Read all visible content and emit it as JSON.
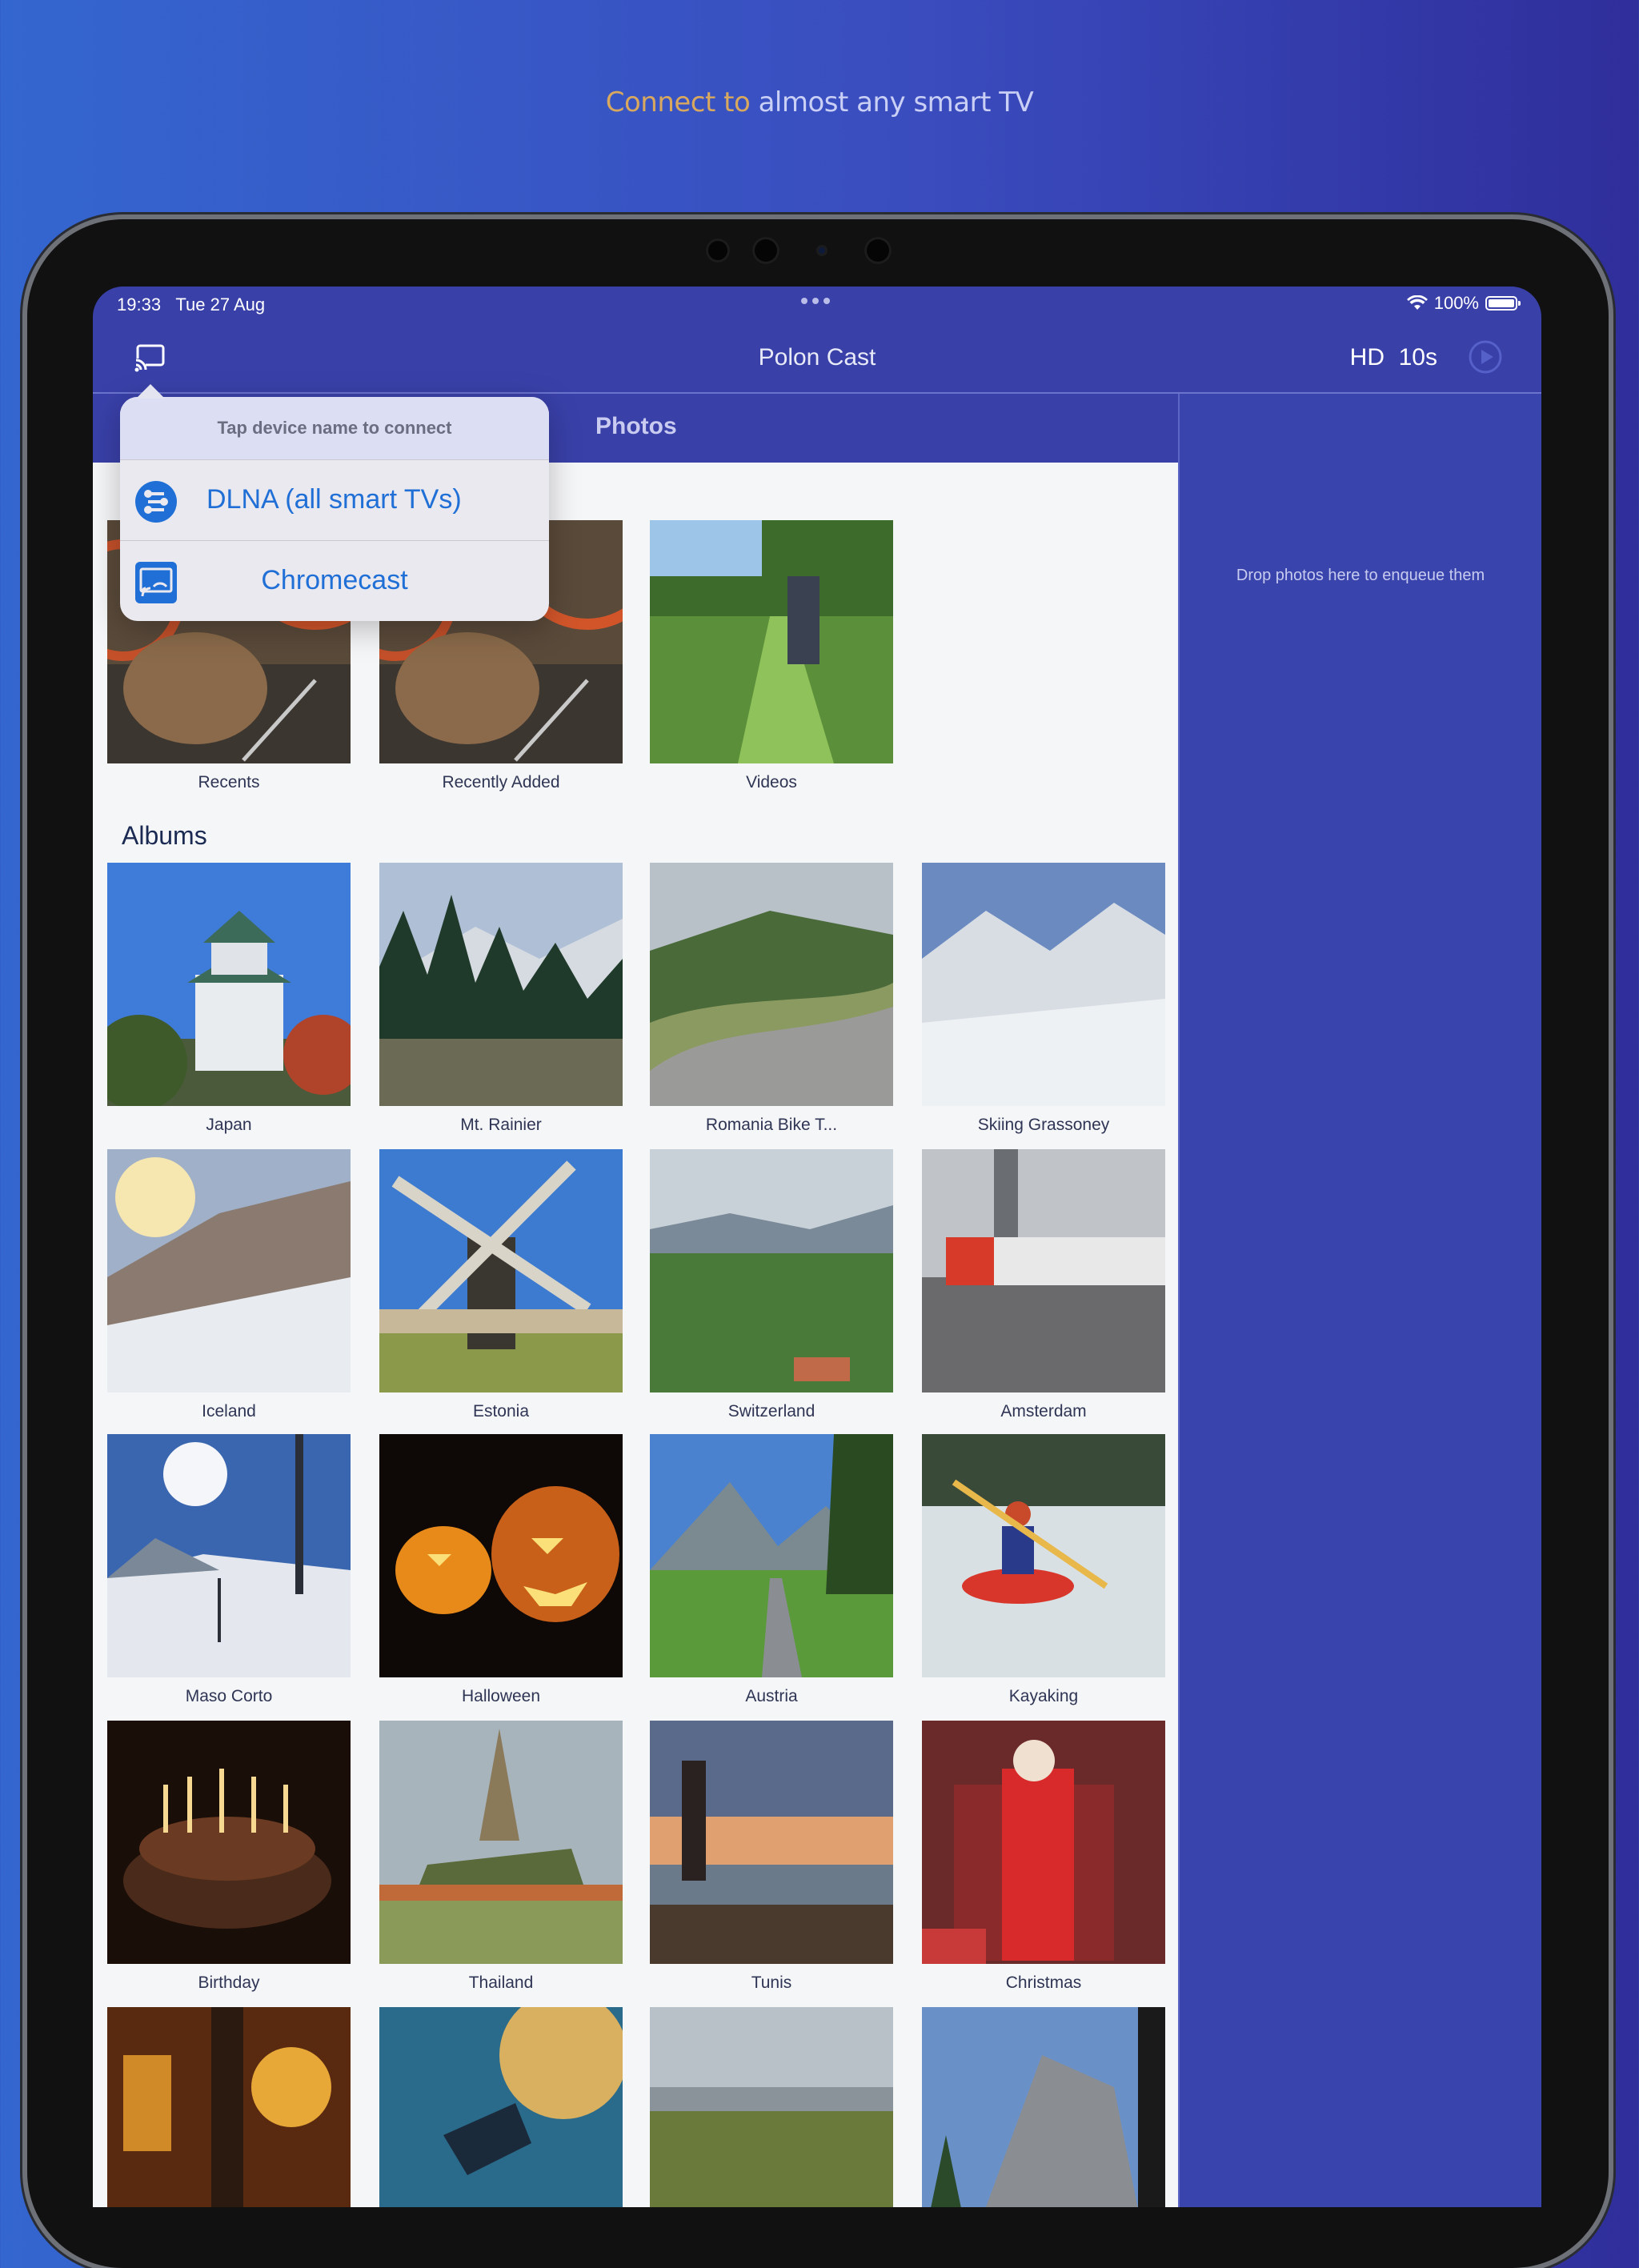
{
  "headline": {
    "part1": "Connect to",
    "part2": " almost any smart TV"
  },
  "status": {
    "time": "19:33",
    "date": "Tue 27 Aug",
    "battery": "100%"
  },
  "nav": {
    "title": "Polon Cast",
    "quality": "HD",
    "interval": "10s"
  },
  "tabs": {
    "photos": "Photos"
  },
  "popover": {
    "header": "Tap device name to connect",
    "items": [
      "DLNA (all smart TVs)",
      "Chromecast"
    ]
  },
  "queue": {
    "hint": "Drop photos here to enqueue them"
  },
  "library": {
    "items": [
      "Recents",
      "Recently Added",
      "Videos"
    ]
  },
  "albums": {
    "title": "Albums",
    "items": [
      "Japan",
      "Mt. Rainier",
      "Romania Bike T...",
      "Skiing Grassoney",
      "Iceland",
      "Estonia",
      "Switzerland",
      "Amsterdam",
      "Maso Corto",
      "Halloween",
      "Austria",
      "Kayaking",
      "Birthday",
      "Thailand",
      "Tunis",
      "Christmas",
      "",
      "",
      "",
      ""
    ]
  },
  "colors": {
    "accent": "#3940a8",
    "link": "#1f6fd6",
    "headline_highlight": "#d9a85f"
  }
}
